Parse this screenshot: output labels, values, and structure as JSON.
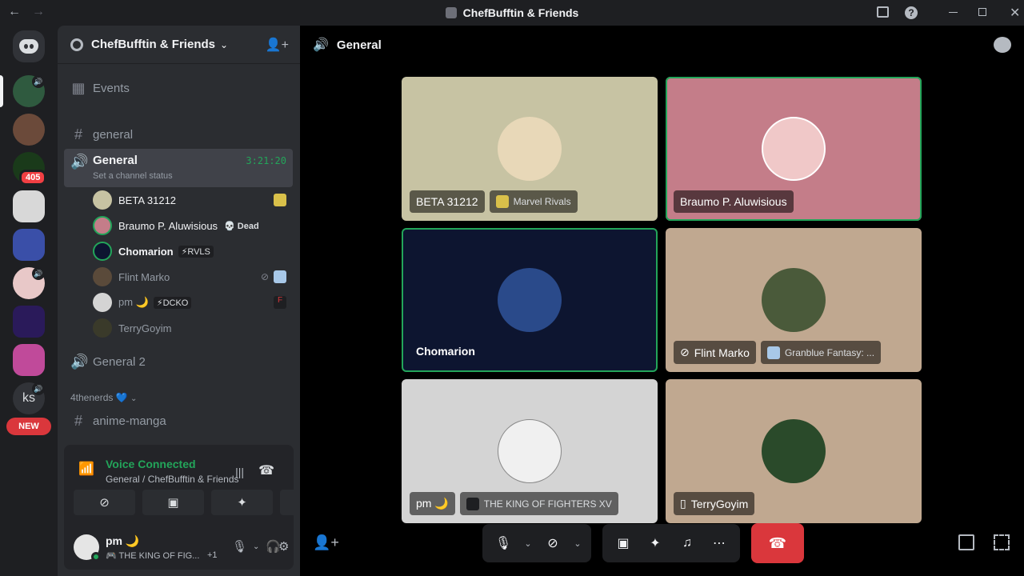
{
  "window": {
    "title": "ChefBufftin & Friends",
    "back": "←",
    "forward": "→",
    "close": "✕"
  },
  "guilds": {
    "badge_count": "405",
    "ks_label": "ks",
    "new_label": "NEW"
  },
  "server": {
    "name": "ChefBufftin & Friends",
    "chevron": "⌄"
  },
  "channels": {
    "events": "Events",
    "general_text": "general",
    "general_voice": "General",
    "call_timer": "3:21:20",
    "channel_status_prompt": "Set a channel status",
    "general2": "General 2",
    "category": "4thenerds 💙",
    "anime": "anime-manga"
  },
  "voice_users": [
    {
      "name": "BETA 31212",
      "tag": ""
    },
    {
      "name": "Braumo P. Aluwisious",
      "tag": "💀 Dead"
    },
    {
      "name": "Chomarion",
      "tag": "⚡RVLS"
    },
    {
      "name": "Flint Marko",
      "tag": ""
    },
    {
      "name": "pm 🌙",
      "tag": "⚡DCKO"
    },
    {
      "name": "TerryGoyim",
      "tag": ""
    }
  ],
  "voice_panel": {
    "status": "Voice Connected",
    "location": "General / ChefBufftin & Friends"
  },
  "user": {
    "name": "pm 🌙",
    "activity": "🎮 THE KING OF FIG...",
    "extra": "+1"
  },
  "stage": {
    "title": "General"
  },
  "tiles": [
    {
      "name": "BETA 31212",
      "game": "Marvel Rivals",
      "bg": "#c7c3a3"
    },
    {
      "name": "Braumo P. Aluwisious",
      "game": "",
      "bg": "#c47d89"
    },
    {
      "name": "Chomarion",
      "game": "",
      "bg": "#0d1530"
    },
    {
      "name": "Flint Marko",
      "game": "Granblue Fantasy: ...",
      "bg": "#c0a890"
    },
    {
      "name": "pm 🌙",
      "game": "THE KING OF FIGHTERS XV",
      "bg": "#d4d4d4"
    },
    {
      "name": "TerryGoyim",
      "game": "",
      "bg": "#c0a890"
    }
  ],
  "colors": {
    "accent_green": "#23a55a",
    "danger_red": "#da373c",
    "badge_red": "#f23f43"
  }
}
